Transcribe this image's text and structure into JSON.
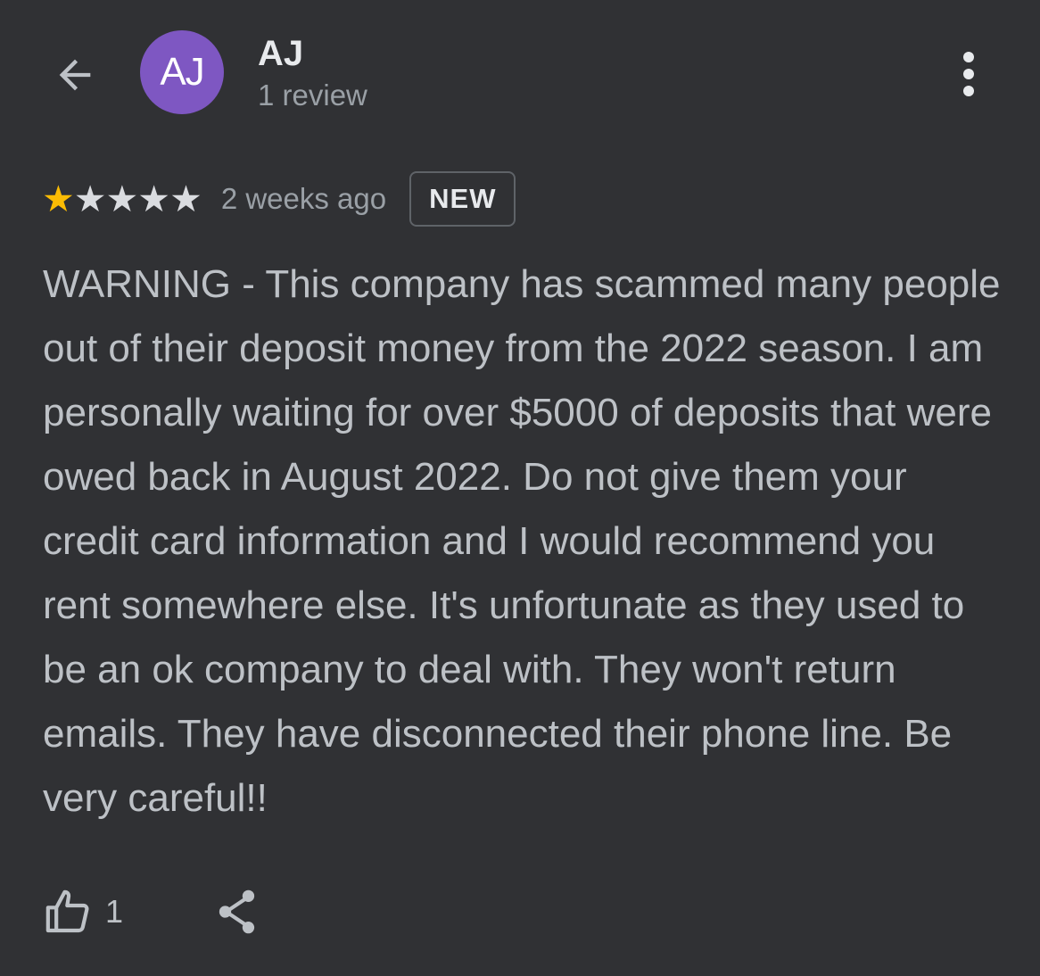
{
  "header": {
    "avatar_initials": "AJ",
    "avatar_color": "#7e57c2",
    "name": "AJ",
    "review_count": "1 review",
    "back_icon": "arrow-left-icon",
    "more_icon": "more-vert-icon"
  },
  "review": {
    "rating": 1,
    "rating_max": 5,
    "star_filled_color": "#fbbc04",
    "star_empty_color": "#dadce0",
    "timestamp": "2 weeks ago",
    "badge": "NEW",
    "text": "WARNING - This company has scammed many people out of their deposit money from the 2022 season. I am personally waiting for over $5000 of deposits that were owed back in August 2022. Do not give them your credit card information and I would recommend you rent somewhere else. It's unfortunate as they used to be an ok company to deal with. They won't return emails. They have disconnected their phone line. Be very careful!!"
  },
  "actions": {
    "like_icon": "thumb-up-icon",
    "like_count": "1",
    "share_icon": "share-icon"
  }
}
